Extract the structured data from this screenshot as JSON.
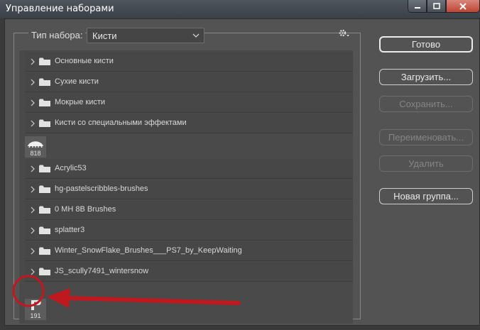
{
  "window": {
    "title": "Управление наборами"
  },
  "header": {
    "type_label": "Тип набора:",
    "type_selected": "Кисти"
  },
  "list": {
    "groups_top": [
      "Основные кисти",
      "Сухие кисти",
      "Мокрые кисти",
      "Кисти со специальными эффектами"
    ],
    "brush_a": {
      "count": "818"
    },
    "groups_bottom": [
      "Acrylic53",
      "hg-pastelscribbles-brushes",
      "0 MH 8B Brushes",
      "splatter3",
      "Winter_SnowFlake_Brushes___PS7_by_KeepWaiting",
      "JS_scully7491_wintersnow"
    ],
    "brush_b": {
      "count": "191"
    }
  },
  "buttons": {
    "done": "Готово",
    "load": "Загрузить...",
    "save": "Сохранить...",
    "rename": "Переименовать...",
    "delete": "Удалить",
    "new_group": "Новая группа..."
  },
  "annotation": {
    "color": "#c0181f"
  }
}
